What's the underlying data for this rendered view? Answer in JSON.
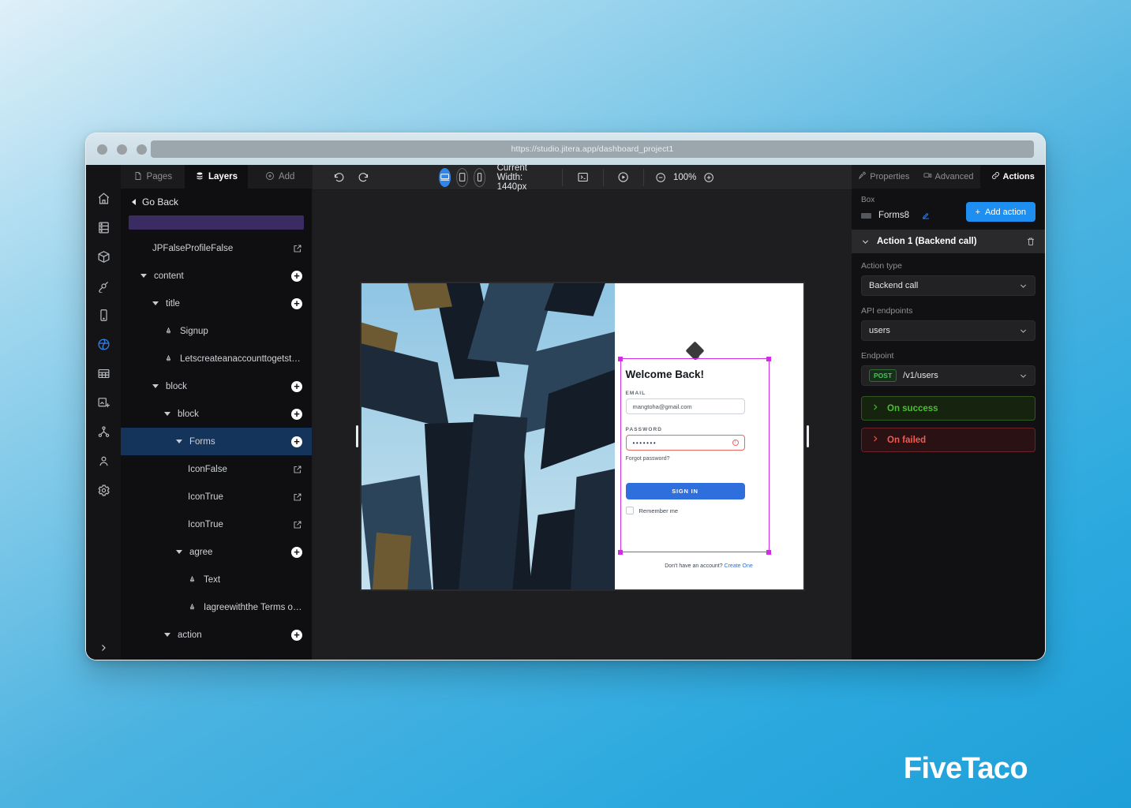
{
  "browser": {
    "url": "https://studio.jitera.app/dashboard_project1",
    "traffic_lights": [
      "close",
      "minimize",
      "maximize"
    ]
  },
  "rail": {
    "items": [
      {
        "name": "home",
        "icon": "home-icon",
        "active": false
      },
      {
        "name": "database",
        "icon": "database-icon",
        "active": false
      },
      {
        "name": "components",
        "icon": "cube-icon",
        "active": false
      },
      {
        "name": "integrations",
        "icon": "plug-icon",
        "active": false
      },
      {
        "name": "mobile",
        "icon": "mobile-icon",
        "active": false
      },
      {
        "name": "web",
        "icon": "globe-icon",
        "active": true
      },
      {
        "name": "tables",
        "icon": "table-icon",
        "active": false
      },
      {
        "name": "media",
        "icon": "image-add-icon",
        "active": false
      },
      {
        "name": "sitemap",
        "icon": "sitemap-icon",
        "active": false
      },
      {
        "name": "users",
        "icon": "user-icon",
        "active": false
      },
      {
        "name": "settings",
        "icon": "gear-icon",
        "active": false
      }
    ],
    "expand_label": "expand"
  },
  "layers_panel": {
    "tabs": [
      {
        "label": "Pages",
        "icon": "page-icon",
        "active": false
      },
      {
        "label": "Layers",
        "icon": "layers-icon",
        "active": true
      },
      {
        "label": "Add",
        "icon": "plus-circle-icon",
        "active": false
      }
    ],
    "go_back": "Go Back",
    "rows": [
      {
        "label": "JPFalseProfileFalse",
        "indent": 2,
        "caret": false,
        "type": "box",
        "action": "edit",
        "selected": false
      },
      {
        "label": "content",
        "indent": 1,
        "caret": true,
        "type": "box",
        "action": "plus",
        "selected": false
      },
      {
        "label": "title",
        "indent": 2,
        "caret": true,
        "type": "box",
        "action": "plus",
        "selected": false
      },
      {
        "label": "Signup",
        "indent": 3,
        "caret": false,
        "type": "text",
        "action": "",
        "selected": false
      },
      {
        "label": "Letscreateanaccounttogetstarted",
        "indent": 3,
        "caret": false,
        "type": "text",
        "action": "",
        "selected": false
      },
      {
        "label": "block",
        "indent": 2,
        "caret": true,
        "type": "box",
        "action": "plus",
        "selected": false
      },
      {
        "label": "block",
        "indent": 3,
        "caret": true,
        "type": "box",
        "action": "plus",
        "selected": false
      },
      {
        "label": "Forms",
        "indent": 4,
        "caret": true,
        "type": "box",
        "action": "plus",
        "selected": true
      },
      {
        "label": "IconFalse",
        "indent": 5,
        "caret": false,
        "type": "box",
        "action": "edit",
        "selected": false
      },
      {
        "label": "IconTrue",
        "indent": 5,
        "caret": false,
        "type": "box",
        "action": "edit",
        "selected": false
      },
      {
        "label": "IconTrue",
        "indent": 5,
        "caret": false,
        "type": "box",
        "action": "edit",
        "selected": false
      },
      {
        "label": "agree",
        "indent": 4,
        "caret": true,
        "type": "box",
        "action": "plus",
        "selected": false
      },
      {
        "label": "Text",
        "indent": 5,
        "caret": false,
        "type": "text",
        "action": "",
        "selected": false
      },
      {
        "label": "Iagreewiththe Terms of servic...",
        "indent": 5,
        "caret": false,
        "type": "text",
        "action": "",
        "selected": false
      },
      {
        "label": "action",
        "indent": 3,
        "caret": true,
        "type": "box",
        "action": "plus",
        "selected": false
      }
    ]
  },
  "toolbar": {
    "undo": "undo-icon",
    "redo": "redo-icon",
    "devices": [
      {
        "name": "desktop",
        "icon": "desktop-icon",
        "active": true
      },
      {
        "name": "tablet",
        "icon": "tablet-icon",
        "active": false
      },
      {
        "name": "phone",
        "icon": "phone-icon",
        "active": false
      }
    ],
    "current_width": "Current Width: 1440px",
    "code_icon": "code-icon",
    "preview_icon": "play-icon",
    "zoom_out_icon": "minus-circle-icon",
    "zoom_level": "100%",
    "zoom_in_icon": "plus-circle-icon"
  },
  "canvas": {
    "form": {
      "title": "Welcome Back!",
      "email_label": "EMAIL",
      "email_value": "mangtoha@gmail.com",
      "password_label": "PASSWORD",
      "password_value": "•••••••",
      "password_error_icon": "error-circle-icon",
      "forgot": "Forgot password?",
      "signin": "SIGN IN",
      "remember": "Remember me",
      "no_account_text": "Don't have an account?",
      "create_one": "Create One"
    },
    "selection": {
      "accent": "#d32ce6",
      "rotate_handle": "rotate-handle-icon"
    }
  },
  "props_panel": {
    "tabs": [
      {
        "label": "Properties",
        "icon": "properties-icon",
        "active": false
      },
      {
        "label": "Advanced",
        "icon": "advanced-icon",
        "active": false
      },
      {
        "label": "Actions",
        "icon": "link-icon",
        "active": true
      }
    ],
    "box_caption": "Box",
    "box_name": "Forms8",
    "box_edit_icon": "pencil-icon",
    "add_action": "Add action",
    "action_title": "Action 1 (Backend call)",
    "delete_icon": "trash-icon",
    "fields": [
      {
        "label": "Action type",
        "value": "Backend call"
      },
      {
        "label": "API endpoints",
        "value": "users"
      }
    ],
    "endpoint_label": "Endpoint",
    "endpoint_method": "POST",
    "endpoint_path": "/v1/users",
    "branches": [
      {
        "label": "On success",
        "color": "#49c02f"
      },
      {
        "label": "On failed",
        "color": "#f2594f"
      }
    ]
  },
  "footer": {
    "logo": "FiveTaco"
  },
  "colors": {
    "accent_blue": "#1f8ef1",
    "selection_magenta": "#d32ce6",
    "success_green": "#49c02f",
    "error_red": "#f2594f",
    "page_bg": "#2ba9df"
  }
}
